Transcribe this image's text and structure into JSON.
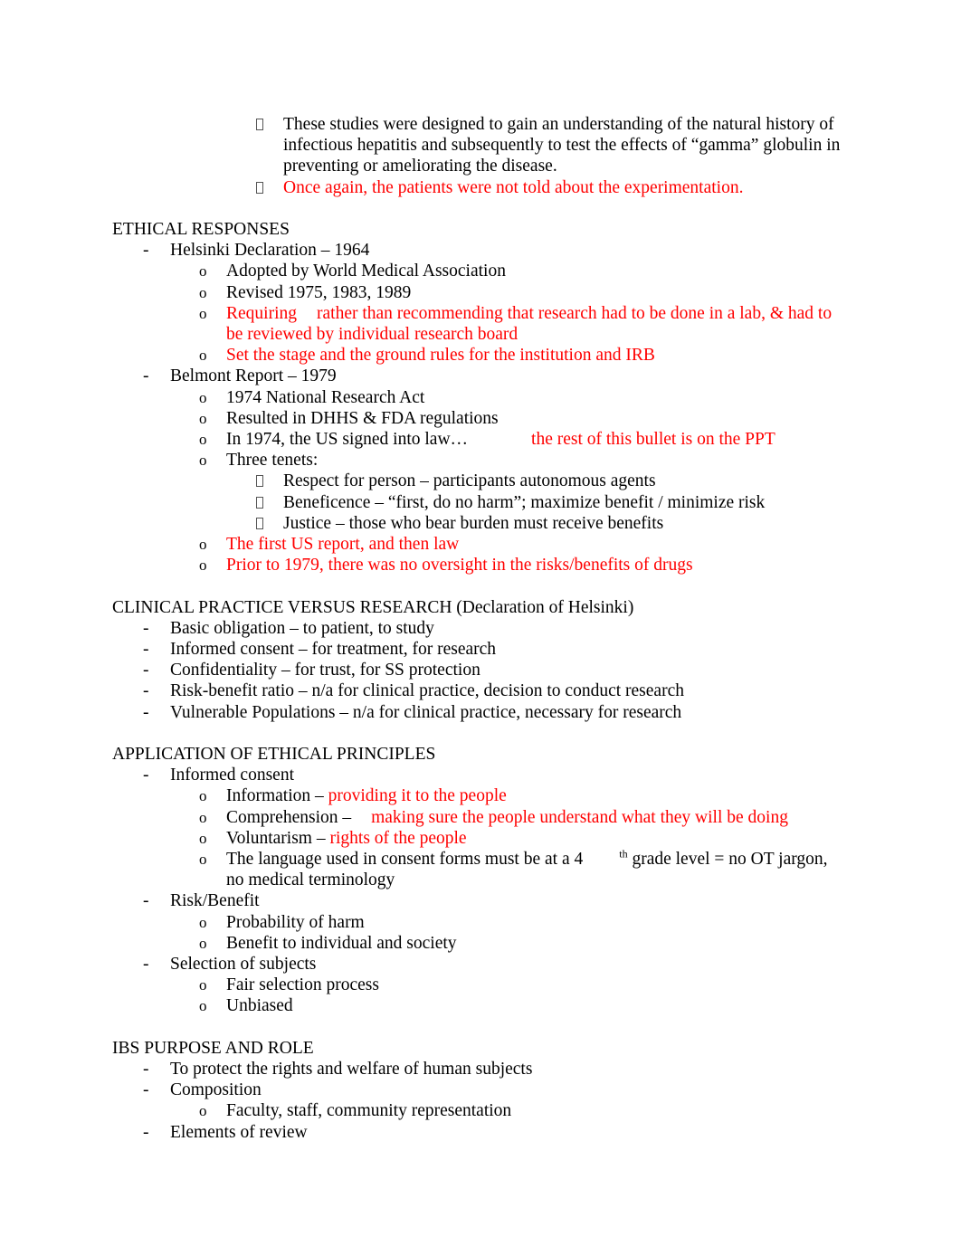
{
  "document": {
    "text_color": "#000000",
    "highlight_color": "#FF0000",
    "blocks": [
      {
        "id": "b1",
        "level": 3,
        "bullet": "tofu",
        "color": "black",
        "text": "These studies were designed to gain an understanding of the natural history of infectious hepatitis and subsequently to test the effects of “gamma” globulin in preventing or ameliorating the disease."
      },
      {
        "id": "b2",
        "level": 3,
        "bullet": "tofu",
        "color": "red",
        "text": "Once again, the patients were not told about the experimentation."
      },
      {
        "id": "blank1",
        "level": 0,
        "bullet": "none",
        "color": "black",
        "text": ""
      },
      {
        "id": "h1",
        "level": 0,
        "bullet": "none",
        "color": "black",
        "text": "ETHICAL RESPONSES"
      },
      {
        "id": "b3",
        "level": 1,
        "bullet": "dash",
        "color": "black",
        "text": "Helsinki Declaration – 1964"
      },
      {
        "id": "b4",
        "level": 2,
        "bullet": "o",
        "color": "black",
        "text": "Adopted by World Medical Association"
      },
      {
        "id": "b5",
        "level": 2,
        "bullet": "o",
        "color": "black",
        "text": "Revised 1975, 1983, 1989"
      },
      {
        "id": "b6",
        "level": 2,
        "bullet": "o",
        "color": "red",
        "text_a": "Requiring",
        "gap": "sm",
        "text_b": "rather than recommending that research had to be done in a lab, & had to be reviewed by individual research board"
      },
      {
        "id": "b7",
        "level": 2,
        "bullet": "o",
        "color": "red",
        "text": "Set the stage and the ground rules for the institution and IRB"
      },
      {
        "id": "b8",
        "level": 1,
        "bullet": "dash",
        "color": "black",
        "text": "Belmont Report – 1979"
      },
      {
        "id": "b9",
        "level": 2,
        "bullet": "o",
        "color": "black",
        "text": "1974 National Research Act"
      },
      {
        "id": "b10",
        "level": 2,
        "bullet": "o",
        "color": "black",
        "text": "Resulted in DHHS & FDA regulations"
      },
      {
        "id": "b11",
        "level": 2,
        "bullet": "o",
        "color": "mixed",
        "text_a": "In 1974, the US signed into law…",
        "gap": "lg",
        "text_b": "the rest of this bullet is on the PPT"
      },
      {
        "id": "b12",
        "level": 2,
        "bullet": "o",
        "color": "black",
        "text": "Three tenets:"
      },
      {
        "id": "b13",
        "level": 3,
        "bullet": "tofu",
        "color": "black",
        "text": "Respect for person – participants autonomous agents"
      },
      {
        "id": "b14",
        "level": 3,
        "bullet": "tofu",
        "color": "black",
        "text": "Beneficence – “first, do no harm”; maximize benefit / minimize risk"
      },
      {
        "id": "b15",
        "level": 3,
        "bullet": "tofu",
        "color": "black",
        "text": "Justice – those who bear burden must receive benefits"
      },
      {
        "id": "b16",
        "level": 2,
        "bullet": "o",
        "color": "red",
        "text": "The first US report, and then law"
      },
      {
        "id": "b17",
        "level": 2,
        "bullet": "o",
        "color": "red",
        "text": "Prior to 1979, there was no oversight in the risks/benefits of drugs"
      },
      {
        "id": "blank2",
        "level": 0,
        "bullet": "none",
        "color": "black",
        "text": ""
      },
      {
        "id": "h2",
        "level": 0,
        "bullet": "none",
        "color": "black",
        "text": "CLINICAL PRACTICE VERSUS RESEARCH (Declaration of Helsinki)"
      },
      {
        "id": "b18",
        "level": 1,
        "bullet": "dash",
        "color": "black",
        "text": "Basic obligation – to patient, to study"
      },
      {
        "id": "b19",
        "level": 1,
        "bullet": "dash",
        "color": "black",
        "text": "Informed consent – for treatment, for research"
      },
      {
        "id": "b20",
        "level": 1,
        "bullet": "dash",
        "color": "black",
        "text": "Confidentiality – for trust, for SS protection"
      },
      {
        "id": "b21",
        "level": 1,
        "bullet": "dash",
        "color": "black",
        "text": "Risk-benefit ratio – n/a for clinical practice, decision to conduct research"
      },
      {
        "id": "b22",
        "level": 1,
        "bullet": "dash",
        "color": "black",
        "text": "Vulnerable Populations – n/a for clinical practice, necessary for research"
      },
      {
        "id": "blank3",
        "level": 0,
        "bullet": "none",
        "color": "black",
        "text": ""
      },
      {
        "id": "h3",
        "level": 0,
        "bullet": "none",
        "color": "black",
        "text": "APPLICATION OF ETHICAL PRINCIPLES"
      },
      {
        "id": "b23",
        "level": 1,
        "bullet": "dash",
        "color": "black",
        "text": "Informed consent"
      },
      {
        "id": "b24",
        "level": 2,
        "bullet": "o",
        "color": "mixed",
        "text_a": "Information –",
        "gap": "none",
        "text_b": "providing it to the people"
      },
      {
        "id": "b25",
        "level": 2,
        "bullet": "o",
        "color": "mixed",
        "text_a": "Comprehension –",
        "gap": "sm",
        "text_b": "making sure the people understand what they will be doing"
      },
      {
        "id": "b26",
        "level": 2,
        "bullet": "o",
        "color": "mixed",
        "text_a": "Voluntarism –",
        "gap": "none",
        "text_b": "rights of the people"
      },
      {
        "id": "b27",
        "level": 2,
        "bullet": "o",
        "color": "black",
        "text_a": "The language used in consent forms must be at a 4",
        "gap": "md",
        "superscript": "th",
        "text_b": " grade level = no OT jargon, no medical terminology"
      },
      {
        "id": "b28",
        "level": 1,
        "bullet": "dash",
        "color": "black",
        "text": "Risk/Benefit"
      },
      {
        "id": "b29",
        "level": 2,
        "bullet": "o",
        "color": "black",
        "text": "Probability of harm"
      },
      {
        "id": "b30",
        "level": 2,
        "bullet": "o",
        "color": "black",
        "text": "Benefit to individual and society"
      },
      {
        "id": "b31",
        "level": 1,
        "bullet": "dash",
        "color": "black",
        "text": "Selection of subjects"
      },
      {
        "id": "b32",
        "level": 2,
        "bullet": "o",
        "color": "black",
        "text": "Fair selection process"
      },
      {
        "id": "b33",
        "level": 2,
        "bullet": "o",
        "color": "black",
        "text": "Unbiased"
      },
      {
        "id": "blank4",
        "level": 0,
        "bullet": "none",
        "color": "black",
        "text": ""
      },
      {
        "id": "h4",
        "level": 0,
        "bullet": "none",
        "color": "black",
        "text": "IBS PURPOSE AND ROLE"
      },
      {
        "id": "b34",
        "level": 1,
        "bullet": "dash",
        "color": "black",
        "text": "To protect the rights and welfare of human subjects"
      },
      {
        "id": "b35",
        "level": 1,
        "bullet": "dash",
        "color": "black",
        "text": "Composition"
      },
      {
        "id": "b36",
        "level": 2,
        "bullet": "o",
        "color": "black",
        "text": "Faculty, staff, community representation"
      },
      {
        "id": "b37",
        "level": 1,
        "bullet": "dash",
        "color": "black",
        "text": "Elements of review"
      }
    ],
    "bullet_glyphs": {
      "dash": "-",
      "o": "o",
      "tofu": ""
    }
  }
}
